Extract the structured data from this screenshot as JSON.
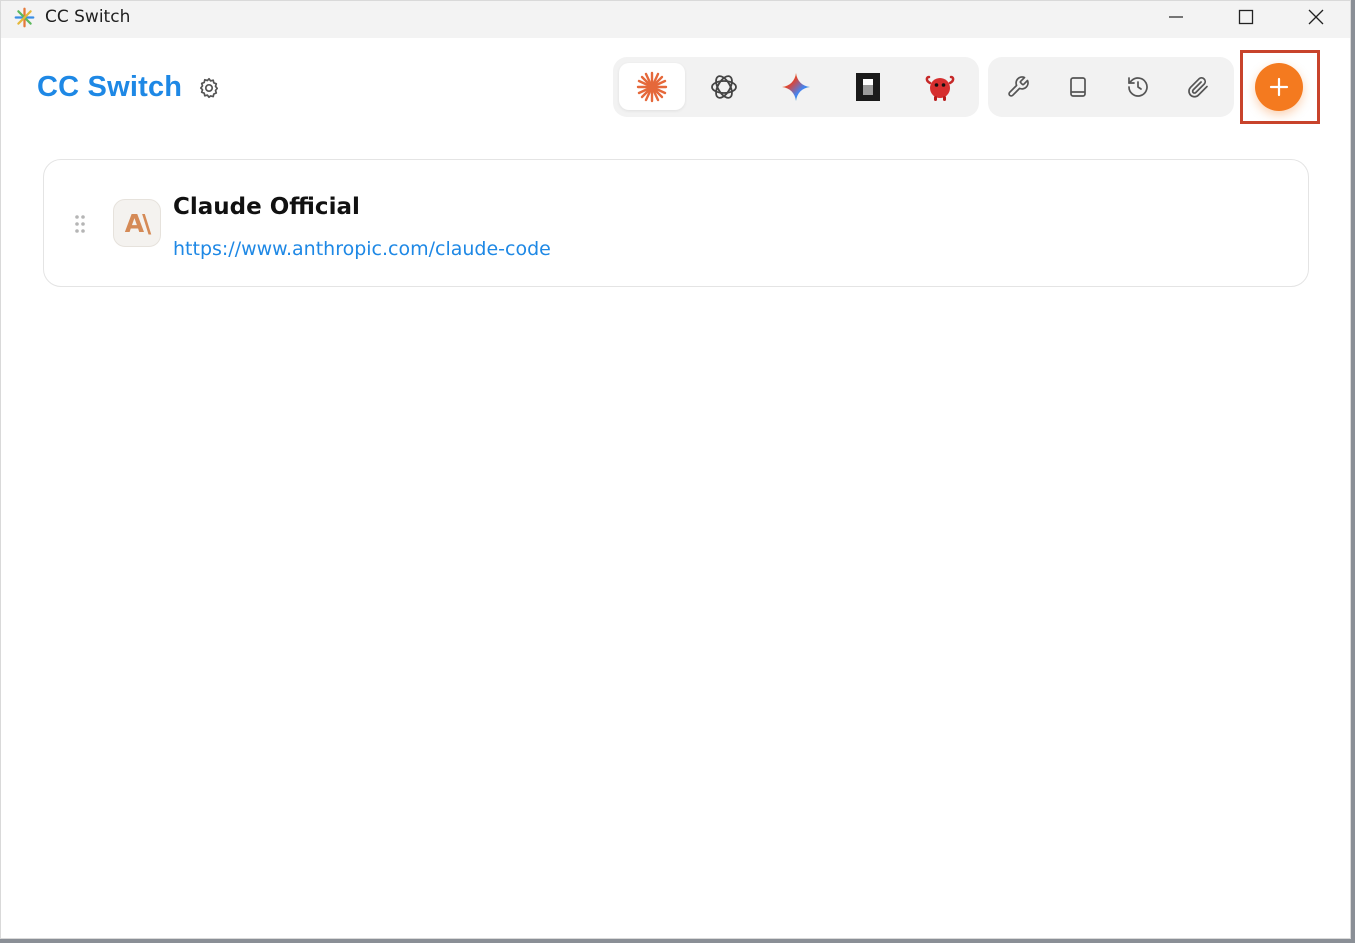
{
  "window": {
    "title": "CC Switch"
  },
  "header": {
    "brand": "CC Switch"
  },
  "app_tabs": [
    {
      "name": "claude",
      "icon": "claude-asterisk-icon",
      "active": true
    },
    {
      "name": "openai",
      "icon": "openai-knot-icon",
      "active": false
    },
    {
      "name": "gemini",
      "icon": "gemini-sparkle-icon",
      "active": false
    },
    {
      "name": "opencode",
      "icon": "opencode-block-icon",
      "active": false
    },
    {
      "name": "openclaw",
      "icon": "red-creature-icon",
      "active": false
    }
  ],
  "tools": [
    {
      "icon": "wrench-icon"
    },
    {
      "icon": "book-icon"
    },
    {
      "icon": "history-icon"
    },
    {
      "icon": "paperclip-icon"
    }
  ],
  "colors": {
    "accent": "#1e88e5",
    "add_button": "#f47a1f",
    "highlight": "#c8432b"
  },
  "providers": [
    {
      "name": "Claude Official",
      "url": "https://www.anthropic.com/claude-code",
      "icon_text": "A\\"
    }
  ]
}
